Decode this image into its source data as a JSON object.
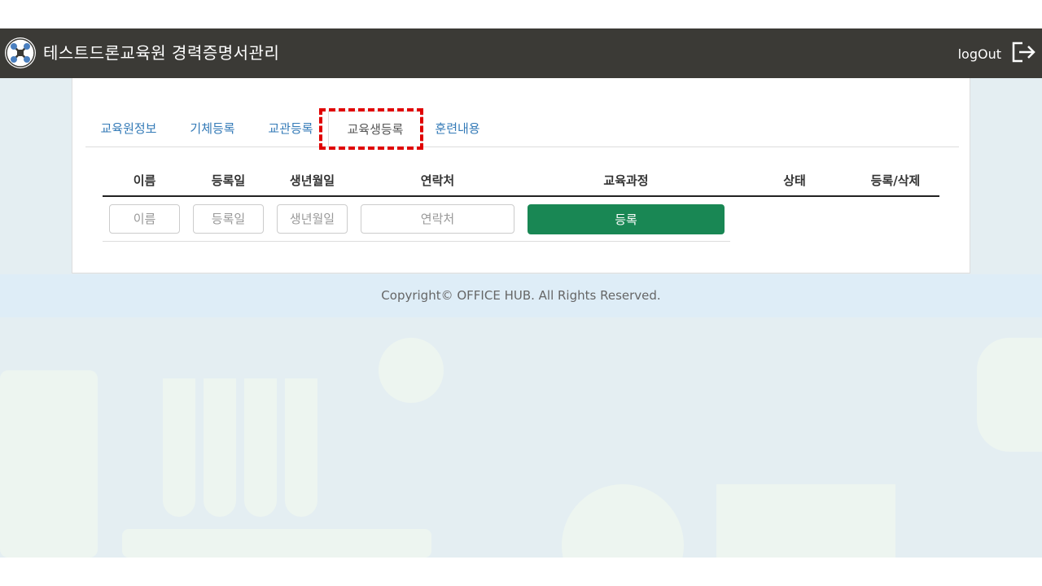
{
  "header": {
    "title": "테스트드론교육원 경력증명서관리",
    "logout_label": "logOut",
    "logo_icon": "drone-logo-icon",
    "logout_icon": "logout-arrow-icon"
  },
  "tabs": [
    {
      "label": "교육원정보",
      "active": false
    },
    {
      "label": "기체등록",
      "active": false
    },
    {
      "label": "교관등록",
      "active": false
    },
    {
      "label": "교육생등록",
      "active": true
    },
    {
      "label": "훈련내용",
      "active": false
    }
  ],
  "table": {
    "columns": [
      "이름",
      "등록일",
      "생년월일",
      "연락처",
      "교육과정",
      "상태",
      "등록/삭제"
    ],
    "form": {
      "name_placeholder": "이름",
      "date_placeholder": "등록일",
      "birth_placeholder": "생년월일",
      "contact_placeholder": "연락처",
      "register_label": "등록"
    }
  },
  "footer": {
    "copyright": "Copyright© OFFICE HUB. All Rights Reserved."
  },
  "colors": {
    "header_bg": "#3b3a36",
    "tab_link": "#337ab7",
    "register_button": "#198754",
    "highlight": "#e00000"
  }
}
